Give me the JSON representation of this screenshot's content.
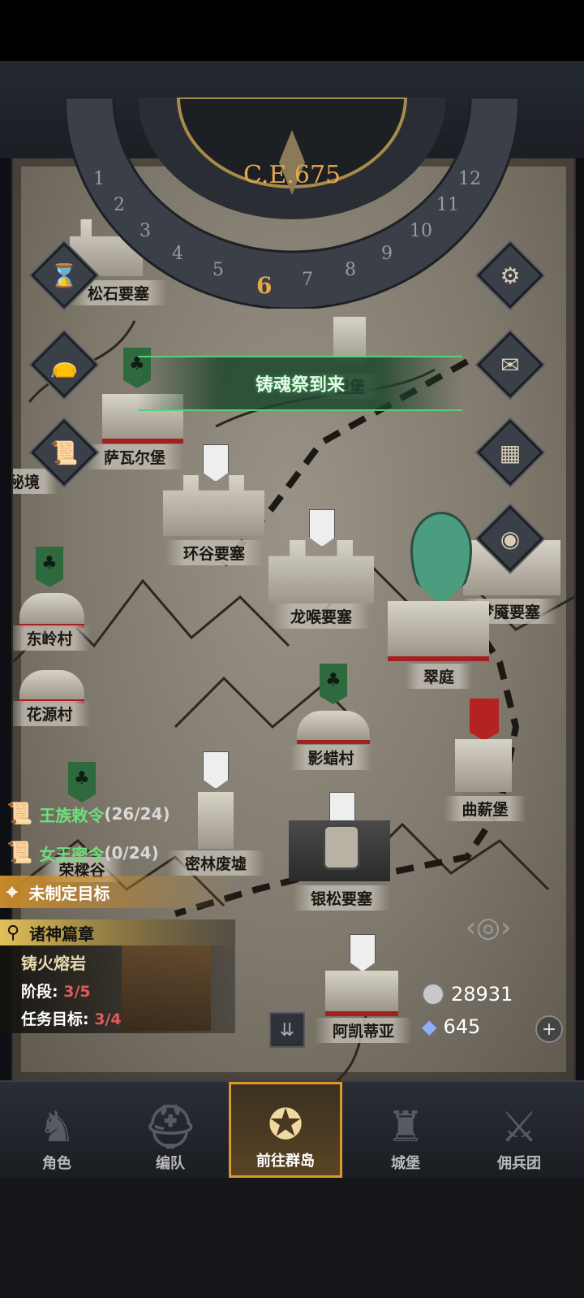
{
  "date_dial": {
    "year": "C.E.675",
    "months": [
      "1",
      "2",
      "3",
      "4",
      "5",
      "6",
      "7",
      "8",
      "9",
      "10",
      "11",
      "12"
    ],
    "current_month": "6"
  },
  "event": {
    "text": "铸魂祭到来"
  },
  "map_locations": [
    {
      "name": "松石要塞",
      "banner": "none"
    },
    {
      "name": "卫堡",
      "banner": "none"
    },
    {
      "name": "萨瓦尔堡",
      "banner": "green"
    },
    {
      "name": "秘境",
      "banner": "none"
    },
    {
      "name": "环谷要塞",
      "banner": "white"
    },
    {
      "name": "龙喉要塞",
      "banner": "white"
    },
    {
      "name": "梦魇要塞",
      "banner": "white"
    },
    {
      "name": "东岭村",
      "banner": "green"
    },
    {
      "name": "翠庭",
      "banner": "player"
    },
    {
      "name": "花源村",
      "banner": "green"
    },
    {
      "name": "影蜡村",
      "banner": "green"
    },
    {
      "name": "曲薪堡",
      "banner": "red"
    },
    {
      "name": "密林废墟",
      "banner": "white"
    },
    {
      "name": "荣樑谷",
      "banner": "green"
    },
    {
      "name": "银松要塞",
      "banner": "locked"
    },
    {
      "name": "阿凯蒂亚",
      "banner": "white"
    }
  ],
  "side_buttons_left": [
    "hourglass-icon",
    "bag-icon",
    "scroll-icon"
  ],
  "side_buttons_right": [
    "gear-icon",
    "mail-icon",
    "grid-icon",
    "coin-icon"
  ],
  "quests": [
    {
      "label": "王族敕令",
      "progress": "(26/24)",
      "color": "#6fe07c"
    },
    {
      "label": "女王密令",
      "progress": "(0/24)",
      "color": "#6fe07c"
    }
  ],
  "goal": {
    "label": "未制定目标"
  },
  "chapter": {
    "title": "诸神篇章",
    "name": "铸火熔岩",
    "stage_label": "阶段: ",
    "stage_value": "3/5",
    "task_label": "任务目标: ",
    "task_value": "3/4"
  },
  "resources": {
    "silver": "28931",
    "crystal": "645"
  },
  "nav": [
    {
      "label": "角色",
      "icon": "knight-icon"
    },
    {
      "label": "编队",
      "icon": "helmet-icon"
    },
    {
      "label": "前往群岛",
      "icon": "compass-icon",
      "active": true
    },
    {
      "label": "城堡",
      "icon": "castle-icon"
    },
    {
      "label": "佣兵团",
      "icon": "mercenary-icon"
    }
  ],
  "colors": {
    "accent": "#d99a2b",
    "event_green": "#58d07a",
    "quest_green": "#6fe07c",
    "stage_red": "#e05a5a"
  }
}
